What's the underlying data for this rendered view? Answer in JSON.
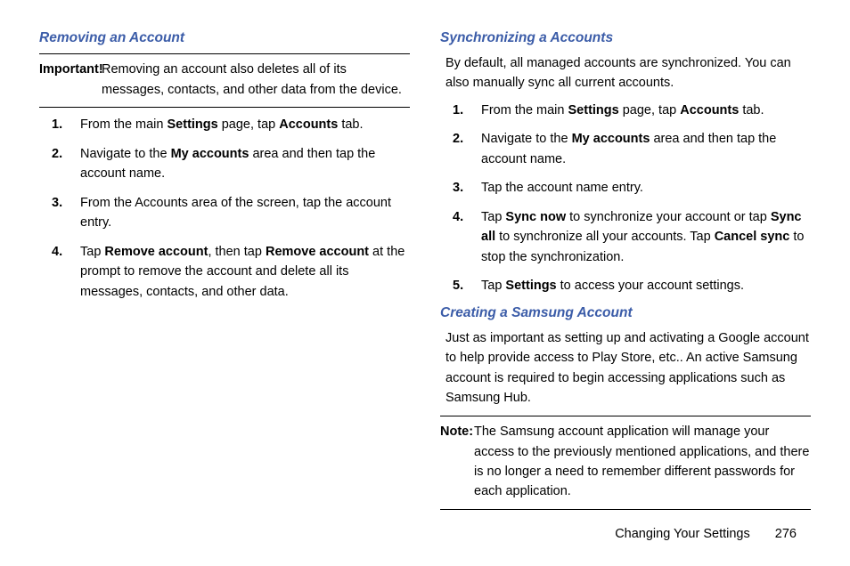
{
  "left": {
    "heading1": "Removing an Account",
    "important_label": "Important!",
    "important_text": "Removing an account also deletes all of its messages, contacts, and other data from the device.",
    "steps1": [
      {
        "pre": "From the main ",
        "b1": "Settings",
        "mid": " page, tap ",
        "b2": "Accounts",
        "post": " tab."
      },
      {
        "pre": "Navigate to the ",
        "b1": "My accounts",
        "mid": " area and then tap the account name.",
        "b2": "",
        "post": ""
      },
      {
        "pre": "From the Accounts area of the screen, tap the account entry.",
        "b1": "",
        "mid": "",
        "b2": "",
        "post": ""
      },
      {
        "pre": "Tap ",
        "b1": "Remove account",
        "mid": ", then tap ",
        "b2": "Remove account",
        "post": " at the prompt to remove the account and delete all its messages, contacts, and other data."
      }
    ]
  },
  "right": {
    "heading2": "Synchronizing a Accounts",
    "intro2": "By default, all managed accounts are synchronized. You can also manually sync all current accounts.",
    "steps2": [
      {
        "pre": "From the main ",
        "b1": "Settings",
        "mid": " page, tap ",
        "b2": "Accounts",
        "post": " tab."
      },
      {
        "pre": "Navigate to the ",
        "b1": "My accounts",
        "mid": " area and then tap the account name.",
        "b2": "",
        "post": ""
      },
      {
        "pre": "Tap the account name entry.",
        "b1": "",
        "mid": "",
        "b2": "",
        "post": ""
      },
      {
        "pre": "Tap ",
        "b1": "Sync now",
        "mid": " to synchronize your account or tap ",
        "b2": "Sync all",
        "post": " to synchronize all your accounts. Tap ",
        "b3": "Cancel sync",
        "post2": " to stop the synchronization."
      },
      {
        "pre": "Tap ",
        "b1": "Settings",
        "mid": " to access your account settings.",
        "b2": "",
        "post": ""
      }
    ],
    "heading3": "Creating a Samsung Account",
    "intro3": "Just as important as setting up and activating a Google account to help provide access to Play Store, etc.. An active Samsung account is required to begin accessing applications such as Samsung Hub.",
    "note_label": "Note:",
    "note_text": "The Samsung account application will manage your access to the previously mentioned applications, and there is no longer a need to remember different passwords for each application."
  },
  "footer": {
    "section": "Changing Your Settings",
    "page": "276"
  }
}
